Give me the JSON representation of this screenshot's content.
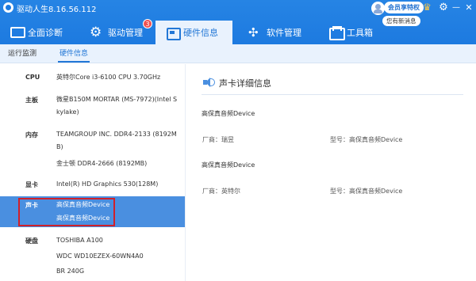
{
  "app": {
    "title": "驱动人生8.16.56.112",
    "icon": "app-logo-icon"
  },
  "member": {
    "badge": "会员享特权",
    "news": "您有新消息"
  },
  "window_controls": {
    "settings": "⚙",
    "minimize": "—",
    "close": "✕"
  },
  "nav": {
    "tabs": [
      {
        "label": "全面诊断",
        "icon": "monitor-icon"
      },
      {
        "label": "驱动管理",
        "icon": "gear-icon",
        "badge": "3"
      },
      {
        "label": "硬件信息",
        "icon": "chip-icon",
        "active": true
      },
      {
        "label": "软件管理",
        "icon": "puzzle-icon"
      },
      {
        "label": "工具箱",
        "icon": "toolbox-icon"
      }
    ]
  },
  "subtabs": [
    {
      "label": "运行监测"
    },
    {
      "label": "硬件信息",
      "active": true
    }
  ],
  "hardware": {
    "cpu": {
      "label": "CPU",
      "value": "英特尔Core i3-6100 CPU 3.70GHz"
    },
    "board": {
      "label": "主板",
      "lines": [
        "微星B150M MORTAR (MS-7972)(Intel S",
        "kylake)"
      ]
    },
    "memory": {
      "label": "内存",
      "lines": [
        "TEAMGROUP INC. DDR4-2133 (8192M",
        "B)",
        "金士顿 DDR4-2666 (8192MB)"
      ]
    },
    "gpu": {
      "label": "显卡",
      "value": "Intel(R) HD Graphics 530(128M)"
    },
    "sound": {
      "label": "声卡",
      "lines": [
        "高保真音频Device",
        "高保真音频Device"
      ]
    },
    "disk": {
      "label": "硬盘",
      "lines": [
        "TOSHIBA A100",
        "WDC WD10EZEX-60WN4A0",
        "BR 240G"
      ]
    }
  },
  "detail": {
    "title": "声卡详细信息",
    "devices": [
      {
        "name": "高保真音频Device",
        "vendor_label": "厂商：",
        "vendor": "瑞昱",
        "model_label": "型号：",
        "model": "高保真音频Device"
      },
      {
        "name": "高保真音频Device",
        "vendor_label": "厂商：",
        "vendor": "英特尔",
        "model_label": "型号：",
        "model": "高保真音频Device"
      }
    ]
  },
  "colors": {
    "header_blue": "#1d7ae0",
    "active_row": "#4a8fe0",
    "highlight": "#d0202a"
  }
}
